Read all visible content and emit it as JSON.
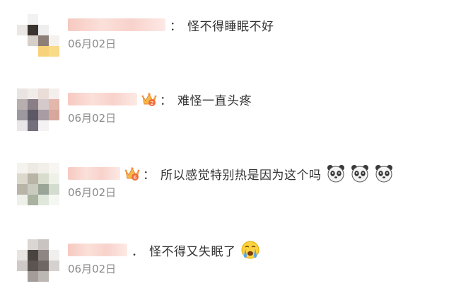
{
  "comments": [
    {
      "separator": "：",
      "text": "怪不得睡眠不好",
      "date": "06月02日",
      "badge": "",
      "emojis": []
    },
    {
      "separator": "：",
      "text": "难怪一直头疼",
      "date": "06月02日",
      "badge": "crown-badge-2",
      "emojis": []
    },
    {
      "separator": "：",
      "text": "所以感觉特别热是因为这个吗",
      "date": "06月02日",
      "badge": "crown-badge-6",
      "emojis": [
        "panda-emoji",
        "panda-emoji",
        "panda-emoji"
      ]
    },
    {
      "separator": "．",
      "text": "怪不得又失眠了",
      "date": "06月02日",
      "badge": "",
      "emojis": [
        "crying-face-emoji"
      ]
    }
  ]
}
